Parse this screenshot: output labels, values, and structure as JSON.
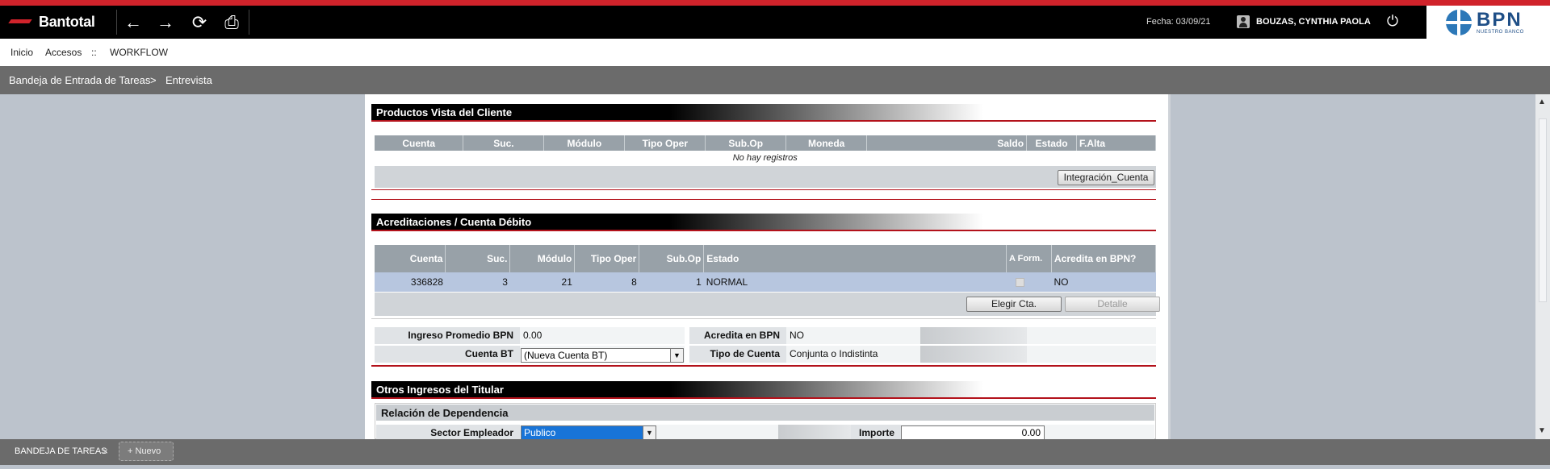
{
  "app": {
    "name": "Bantotal",
    "fecha": "Fecha: 03/09/21",
    "user": "BOUZAS, CYNTHIA PAOLA",
    "bank": "BPN",
    "bank_sub": "NUESTRO BANCO"
  },
  "toolbar": {
    "back": "←",
    "forward": "→",
    "refresh": "⟳",
    "print": "⎙",
    "power": "⏻"
  },
  "menu": {
    "items": [
      "Inicio",
      "Accesos",
      "::",
      "WORKFLOW"
    ]
  },
  "breadcrumb": {
    "items": [
      "Bandeja de Entrada de Tareas",
      "Entrevista"
    ],
    "sep": ">"
  },
  "productos": {
    "title": "Productos Vista del Cliente",
    "columns": [
      "Cuenta",
      "Suc.",
      "Módulo",
      "Tipo Oper",
      "Sub.Op",
      "Moneda",
      "Saldo",
      "Estado",
      "F.Alta"
    ],
    "empty_text": "No hay registros",
    "button": "Integración_Cuenta"
  },
  "acreditaciones": {
    "title": "Acreditaciones / Cuenta Débito",
    "columns": [
      "Cuenta",
      "Suc.",
      "Módulo",
      "Tipo Oper",
      "Sub.Op",
      "Estado",
      "A Form.",
      "Acredita en BPN?"
    ],
    "rows": [
      {
        "cuenta": "336828",
        "suc": "3",
        "modulo": "21",
        "tipo": "8",
        "subop": "1",
        "estado": "NORMAL",
        "acredita": "NO"
      }
    ],
    "btn_elegir": "Elegir Cta.",
    "btn_detalle": "Detalle"
  },
  "form": {
    "ingreso_label": "Ingreso Promedio BPN",
    "ingreso_value": "0.00",
    "acredita_label": "Acredita en BPN",
    "acredita_value": "NO",
    "cuenta_label": "Cuenta BT",
    "cuenta_value": "(Nueva Cuenta BT)",
    "tipo_label": "Tipo de Cuenta",
    "tipo_value": "Conjunta o Indistinta"
  },
  "otros": {
    "title": "Otros Ingresos del Titular",
    "sub_title": "Relación de Dependencia",
    "sector_label": "Sector Empleador",
    "sector_value": "Publico",
    "importe_label": "Importe",
    "importe_value": "0.00"
  },
  "tabs": {
    "active": "BANDEJA DE TAREAS",
    "close": "×",
    "new": "Nuevo",
    "new_icon": "+"
  },
  "scroll": {
    "up": "▲",
    "down": "▼"
  }
}
